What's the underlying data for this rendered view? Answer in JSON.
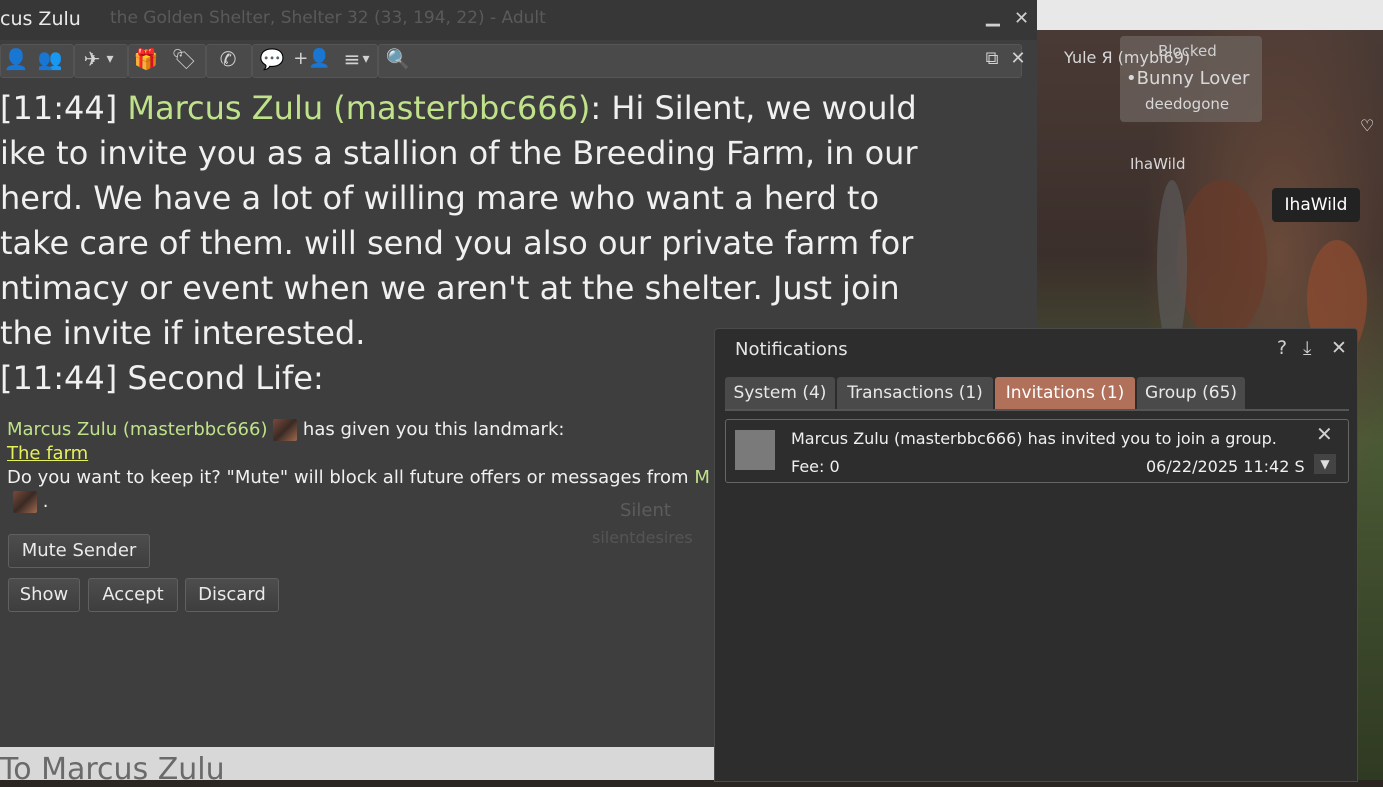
{
  "window": {
    "title": "cus Zulu",
    "ghost_title": "the Golden Shelter, Shelter 32 (33, 194, 22) - Adult",
    "minimize_glyph": "▁",
    "close_glyph": "✕"
  },
  "toolbar": {
    "icons": [
      "profile-icon",
      "friends-icon",
      "teleport-icon",
      "gift-icon",
      "pay-icon",
      "call-icon",
      "im-icon",
      "add-friend-icon",
      "more-icon",
      "search-icon"
    ],
    "glyphs": {
      "profile": "👤",
      "friends": "👥",
      "teleport": "✈",
      "gift": "🎁",
      "pay": "🏷",
      "call": "✆",
      "im": "💬",
      "add_friend": "+👤",
      "more": "≡",
      "search": "🔍",
      "dropdown": "▾",
      "undock": "⧉",
      "close": "✕"
    }
  },
  "chat": {
    "msg1_time": "[11:44] ",
    "msg1_name": "Marcus Zulu (masterbbc666)",
    "msg1_lines": [
      ": Hi Silent, we would",
      "ike to invite you as a stallion of the Breeding Farm, in our",
      "herd. We have a lot of willing mare who want a herd to",
      "take care of them. will send you also our private farm for",
      "ntimacy or event when we aren't at the shelter. Just join",
      "the invite if interested."
    ],
    "msg2": "[11:44] Second Life:"
  },
  "offer": {
    "sender": "Marcus Zulu (masterbbc666)",
    "text": " has given you this landmark:",
    "link": "The farm",
    "question": "Do you want to keep it? \"Mute\" will block all future offers or messages from ",
    "question_tail": "M",
    "end": " .",
    "mute_button": "Mute Sender",
    "show_button": "Show",
    "accept_button": "Accept",
    "discard_button": "Discard"
  },
  "input": {
    "placeholder": "To Marcus Zulu"
  },
  "scene": {
    "tags": {
      "yule": "Yule Я (mybi69)",
      "blocked": "Blocked",
      "bunny": "•Bunny Lover",
      "deedogone": "deedogone",
      "ihawild_small": "IhaWild",
      "ihawild_big": "IhaWild",
      "silent": "Silent",
      "silentdesires": "silentdesires"
    },
    "heart_glyph": "♡"
  },
  "notifications": {
    "title": "Notifications",
    "help_glyph": "?",
    "dock_glyph": "⤓",
    "close_glyph": "✕",
    "tabs": [
      {
        "label": "System (4)",
        "active": false
      },
      {
        "label": "Transactions (1)",
        "active": false
      },
      {
        "label": "Invitations (1)",
        "active": true
      },
      {
        "label": "Group (65)",
        "active": false
      }
    ],
    "item": {
      "message": "Marcus Zulu (masterbbc666) has invited you to join a group.",
      "fee": "Fee: 0",
      "date": "06/22/2025 11:42 S",
      "close_glyph": "✕",
      "dropdown_glyph": "▼"
    }
  },
  "colors": {
    "name_green": "#bfe28a",
    "link_yellow": "#e6f05a",
    "active_tab": "#b0705a"
  }
}
